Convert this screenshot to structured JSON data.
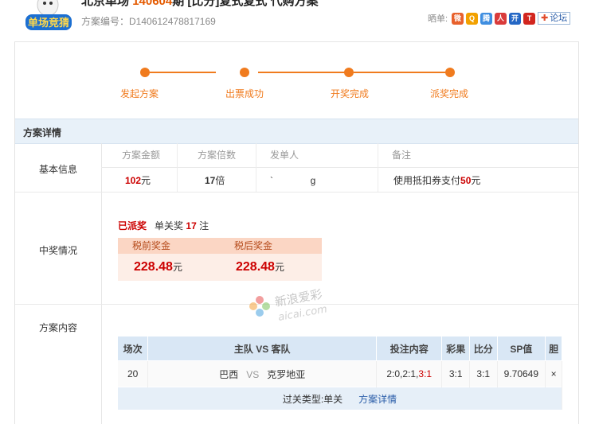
{
  "header": {
    "title_prefix": "北京单场",
    "title_issue": "140604",
    "title_suffix": "期 [比分]复式复式 代购方案",
    "plan_no_label": "方案编号：",
    "plan_no": "D140612478817169",
    "logo_text": "单场竞猜",
    "share_label": "晒单:",
    "forum_label": "论坛"
  },
  "steps": [
    "发起方案",
    "出票成功",
    "开奖完成",
    "派奖完成"
  ],
  "section_title": "方案详情",
  "basic": {
    "label": "基本信息",
    "headers": [
      "方案金额",
      "方案倍数",
      "发单人",
      "备注"
    ],
    "amount": "102",
    "amount_unit": "元",
    "multiple": "17",
    "multiple_unit": "倍",
    "issuer": "`              g",
    "remark_prefix": "使用抵扣券支付",
    "remark_amount": "50",
    "remark_unit": "元"
  },
  "win": {
    "label": "中奖情况",
    "status": "已派奖",
    "desc_prefix": "单关奖",
    "count": "17",
    "count_unit": "注",
    "pre_tax_label": "税前奖金",
    "post_tax_label": "税后奖金",
    "pre_tax": "228.48",
    "post_tax": "228.48",
    "unit": "元"
  },
  "content": {
    "label": "方案内容",
    "watermark_cn": "新浪爱彩",
    "watermark_en": "aicai.com",
    "columns": [
      "场次",
      "主队 VS 客队",
      "投注内容",
      "彩果",
      "比分",
      "SP值",
      "胆"
    ],
    "row": {
      "match_no": "20",
      "home": "巴西",
      "vs": "VS",
      "away": "克罗地亚",
      "bet_prefix": "2:0,2:1,",
      "bet_hit": "3:1",
      "result": "3:1",
      "score": "3:1",
      "sp": "9.70649",
      "banker": "×"
    },
    "footer_label": "过关类型:单关",
    "footer_link": "方案详情"
  },
  "colors": {
    "accent": "#f07b1e",
    "prize_red": "#cc0000",
    "header_blue": "#d9e7f5"
  }
}
